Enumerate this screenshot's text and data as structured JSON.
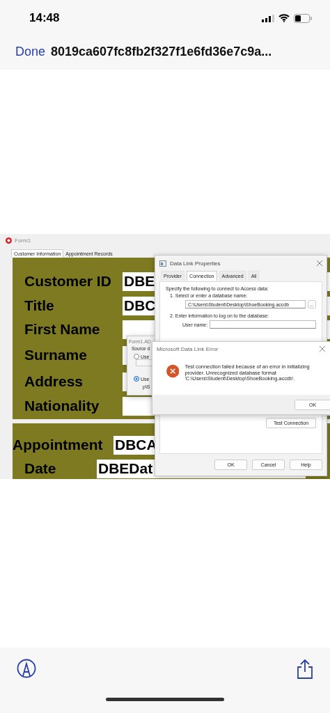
{
  "status_bar": {
    "time": "14:48"
  },
  "nav": {
    "done": "Done",
    "title": "8019ca607fc8fb2f327f1e6fd36e7c9a..."
  },
  "screenshot": {
    "form": {
      "title": "Form1",
      "tabs": [
        {
          "label": "Customer Information",
          "selected": true
        },
        {
          "label": "Appointment Records",
          "selected": false
        }
      ],
      "customer_fields": [
        {
          "label": "Customer ID",
          "value": "DBE"
        },
        {
          "label": "Title",
          "value": "DBC"
        },
        {
          "label": "First Name"
        },
        {
          "label": "Surname"
        },
        {
          "label": "Address"
        },
        {
          "label": "Nationality"
        }
      ],
      "appointment_fields": [
        {
          "label": "Appointment",
          "value": "DBCA"
        },
        {
          "label": "Date",
          "value": "DBEDat"
        }
      ]
    },
    "ado_dialog": {
      "title": "Form1.AD",
      "source_label": "Source d",
      "options": [
        {
          "label": "Use",
          "selected": false
        },
        {
          "label": "Use",
          "selected": true
        }
      ],
      "connection_value": "p\\S"
    },
    "data_link": {
      "title": "Data Link Properties",
      "tabs": [
        {
          "label": "Provider",
          "selected": false
        },
        {
          "label": "Connection",
          "selected": true
        },
        {
          "label": "Advanced",
          "selected": false
        },
        {
          "label": "All",
          "selected": false
        }
      ],
      "intro": "Specify the following to connect to Access data:",
      "step_1": "1. Select or enter a database name:",
      "database": "C:\\Users\\Student\\Desktop\\ShoeBooking.accdb",
      "browse": "...",
      "step_2": "2. Enter information to log on to the database:",
      "user_label": "User name:",
      "test_button": "Test Connection",
      "buttons": [
        "OK",
        "Cancel",
        "Help"
      ]
    },
    "error": {
      "title": "Microsoft Data Link Error",
      "message": "Test connection failed because of an error in initializing provider. Unrecognized database format 'C:\\Users\\Student\\Desktop\\ShoeBooking.accdb'.",
      "button": "OK"
    }
  }
}
